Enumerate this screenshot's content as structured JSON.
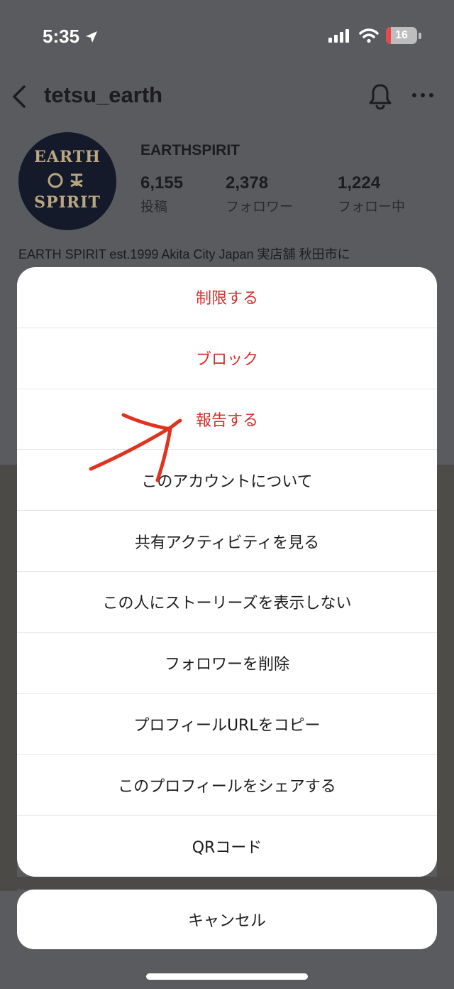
{
  "status_bar": {
    "time": "5:35",
    "battery_level": "16",
    "battery_fraction": 0.16,
    "icons": [
      "location-arrow-icon",
      "cellular-signal-icon",
      "wifi-icon",
      "battery-icon"
    ]
  },
  "profile": {
    "username": "tetsu_earth",
    "display_name": "EARTHSPIRIT",
    "avatar_text_line1": "EARTH",
    "avatar_text_line2": "SPIRIT",
    "stats": [
      {
        "value": "6,155",
        "label": "投稿"
      },
      {
        "value": "2,378",
        "label": "フォロワー"
      },
      {
        "value": "1,224",
        "label": "フォロー中"
      }
    ],
    "bio": "EARTH SPIRIT est.1999 Akita City Japan 実店舗 秋田市に"
  },
  "sheet": {
    "items": [
      {
        "label": "制限する",
        "style": "destructive"
      },
      {
        "label": "ブロック",
        "style": "destructive"
      },
      {
        "label": "報告する",
        "style": "destructive"
      },
      {
        "label": "このアカウントについて",
        "style": "default"
      },
      {
        "label": "共有アクティビティを見る",
        "style": "default"
      },
      {
        "label": "この人にストーリーズを表示しない",
        "style": "default"
      },
      {
        "label": "フォロワーを削除",
        "style": "default"
      },
      {
        "label": "プロフィールURLをコピー",
        "style": "default"
      },
      {
        "label": "このプロフィールをシェアする",
        "style": "default"
      },
      {
        "label": "QRコード",
        "style": "default"
      }
    ],
    "cancel_label": "キャンセル"
  },
  "colors": {
    "destructive": "#d0312d",
    "annotation": "#e0331f",
    "overlay": "#5a5b5f",
    "sheet": "#ffffff"
  }
}
